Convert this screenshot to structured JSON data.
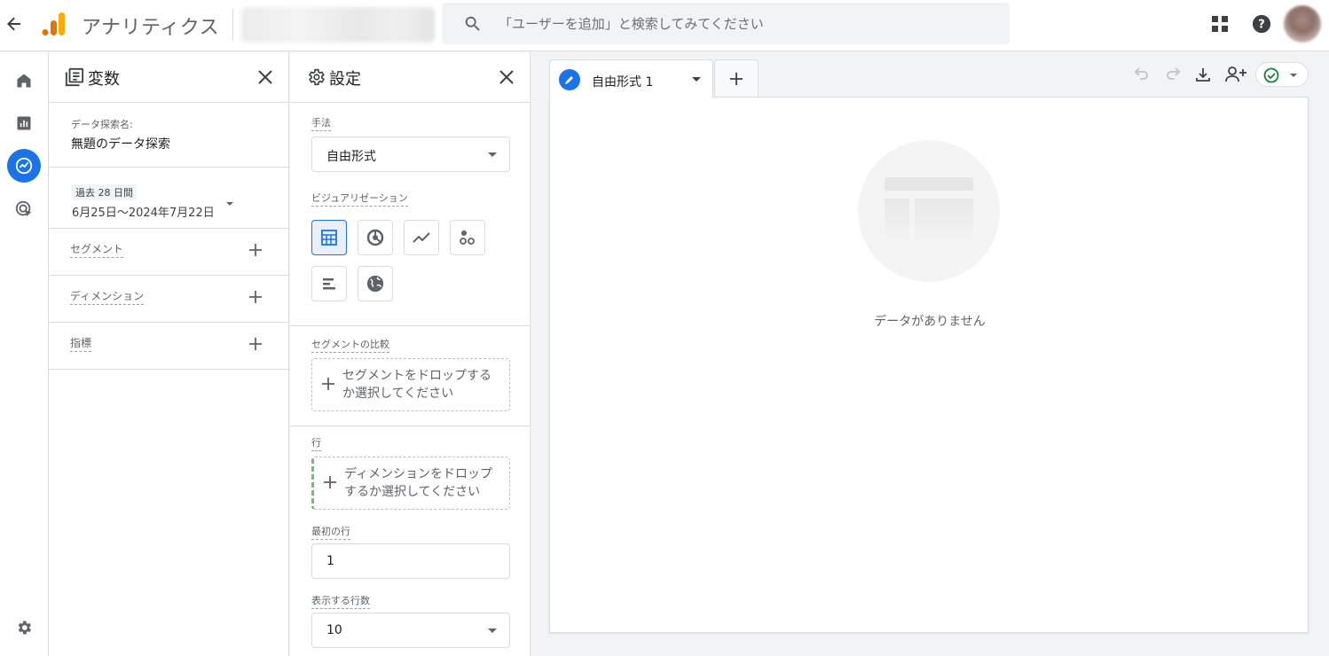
{
  "app": {
    "title": "アナリティクス"
  },
  "search": {
    "placeholder": "「ユーザーを追加」と検索してみてください"
  },
  "rail": {
    "items": [
      "home",
      "reports",
      "explore",
      "advertising"
    ],
    "bottom": "admin"
  },
  "variables": {
    "title": "変数",
    "explore_name_label": "データ探索名:",
    "explore_name_value": "無題のデータ探索",
    "date_chip": "過去 28 日間",
    "date_range": "6月25日～2024年7月22日",
    "segments_label": "セグメント",
    "dimensions_label": "ディメンション",
    "metrics_label": "指標"
  },
  "settings": {
    "title": "設定",
    "technique_label": "手法",
    "technique_value": "自由形式",
    "visualization_label": "ビジュアリゼーション",
    "visualizations": [
      "table",
      "donut",
      "line",
      "scatter",
      "bar",
      "geo-map"
    ],
    "segment_compare_label": "セグメントの比較",
    "segment_drop_text": "セグメントをドロップするか選択してください",
    "rows_label": "行",
    "rows_drop_text": "ディメンションをドロップするか選択してください",
    "first_row_label": "最初の行",
    "first_row_value": "1",
    "show_rows_label": "表示する行数",
    "show_rows_value": "10"
  },
  "canvas": {
    "tab_label": "自由形式 1",
    "empty_text": "データがありません"
  },
  "colors": {
    "accent": "#1a73e8",
    "logo_orange": "#f9ab00",
    "logo_dark": "#e37400",
    "success": "#188038"
  }
}
